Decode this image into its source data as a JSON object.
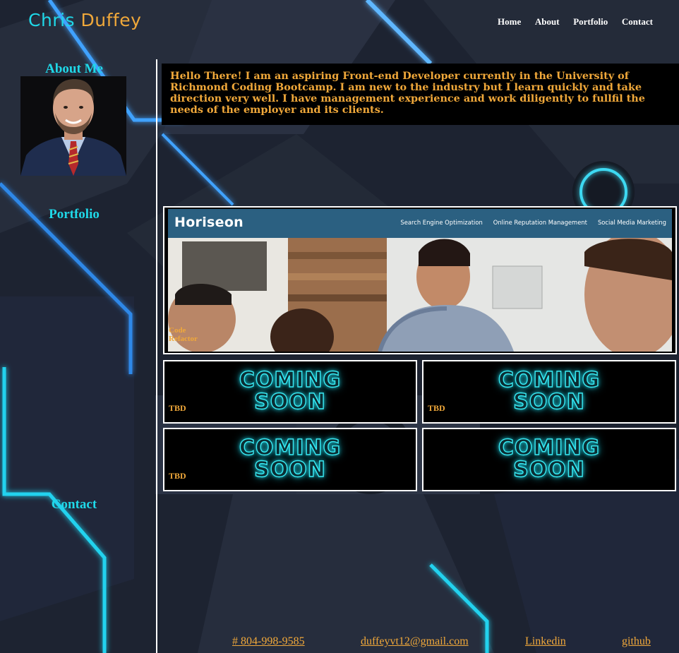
{
  "header": {
    "brand_first": "Chris",
    "brand_last": "Duffey",
    "nav": [
      "Home",
      "About",
      "Portfolio",
      "Contact"
    ]
  },
  "sidebar": {
    "about_heading": "About Me",
    "portfolio_heading": "Portfolio",
    "contact_heading": "Contact"
  },
  "intro": {
    "text": "Hello There! I am an aspiring Front-end Developer currently in the University of Richmond Coding Bootcamp. I am new to the industry but I learn quickly and take direction very well. I have management experience and work diligently to fullfil the needs of the employer and its clients."
  },
  "portfolio": {
    "featured": {
      "logo": "Horiseon",
      "nav": [
        "Search Engine Optimization",
        "Online Reputation Management",
        "Social Media Marketing"
      ],
      "label_line1": "Code",
      "label_line2": "Refactor"
    },
    "coming_soon_line1": "COMING",
    "coming_soon_line2": "SOON",
    "tiles": [
      {
        "label": "TBD"
      },
      {
        "label": "TBD"
      },
      {
        "label": "TBD"
      },
      {
        "label": ""
      }
    ]
  },
  "contact": {
    "phone": "# 804-998-9585",
    "email": "duffeyvt12@gmail.com",
    "linkedin": "Linkedin",
    "github": "github"
  },
  "colors": {
    "accent_cyan": "#1fd8e8",
    "accent_orange": "#f0a83a",
    "background": "#1c2230"
  }
}
